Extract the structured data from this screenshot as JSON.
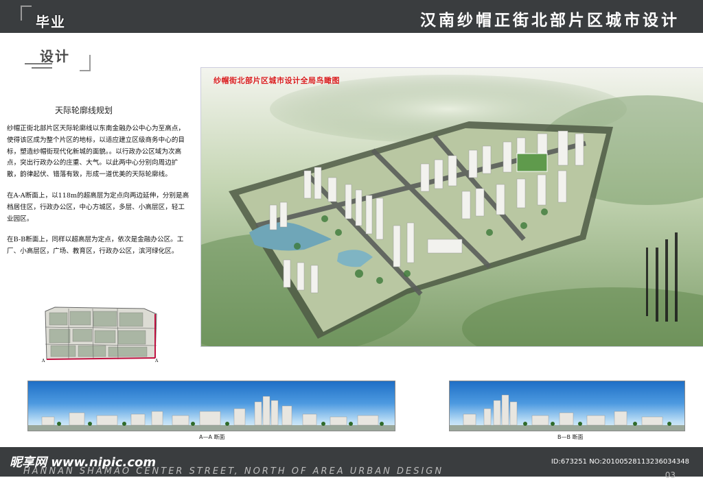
{
  "header": {
    "title": "汉南纱帽正街北部片区城市设计",
    "corner_line1": "毕业",
    "corner_line2": "设计"
  },
  "left_panel": {
    "heading": "天际轮廓线规划",
    "paragraphs": [
      "纱帽正街北部片区天际轮廓线以东南金融办公中心为至高点，使得该区成为整个片区的地标，以适应建立区级商务中心的目标，塑造纱帽街现代化新城的面貌。。以行政办公区域为次高点，突出行政办公的庄重、大气。以此两中心分别向周边扩散，韵律起伏、错落有致，形成一道优美的天际轮廓线。",
      "在A-A断面上，以118m的超高层为定点向两边延伸，分别是高档居住区，行政办公区，中心方城区，多层、小高层区，轻工业园区。",
      "在B-B断面上，同样以超高层为定点，依次是金融办公区。工厂、小高层区，广场、教育区，行政办公区，滨河绿化区。"
    ],
    "map_marker": "A"
  },
  "aerial": {
    "title": "纱帽街北部片区城市设计全局鸟瞰图"
  },
  "sections": {
    "a_label": "A—A 断面",
    "b_label": "B—B 断面"
  },
  "footer": {
    "english": "HANNAN SHAMAO CENTER STREET, NORTH OF AREA URBAN DESIGN",
    "watermark": "昵享网 www.nipic.com",
    "id": "ID:673251 NO:20100528113236034348",
    "page": "03"
  },
  "colors": {
    "bar": "#3a3d3f",
    "aerial_title": "#d61a1a",
    "sky": "#1f6fc6"
  }
}
